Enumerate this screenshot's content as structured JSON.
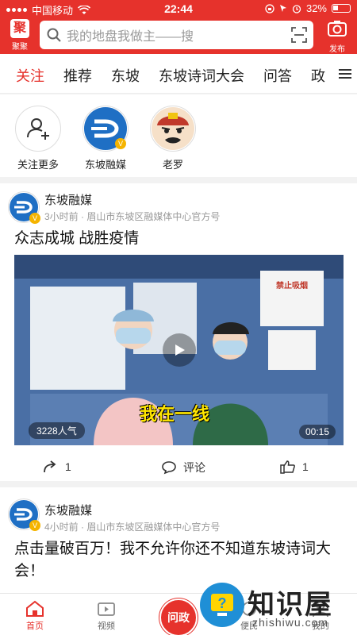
{
  "status_bar": {
    "carrier": "中国移动",
    "time": "22:44",
    "battery": "32%"
  },
  "header": {
    "logo_label": "聚聚",
    "search_placeholder": "我的地盘我做主——搜",
    "publish_label": "发布"
  },
  "tabs": [
    {
      "label": "关注",
      "active": true
    },
    {
      "label": "推荐"
    },
    {
      "label": "东坡"
    },
    {
      "label": "东坡诗词大会"
    },
    {
      "label": "问答"
    },
    {
      "label": "政"
    }
  ],
  "follow": {
    "items": [
      {
        "name": "关注更多"
      },
      {
        "name": "东坡融媒"
      },
      {
        "name": "老罗"
      }
    ]
  },
  "posts": [
    {
      "author": "东坡融媒",
      "meta": "3小时前 · 眉山市东坡区融媒体中心官方号",
      "title": "众志成城 战胜疫情",
      "video": {
        "views": "3228人气",
        "duration": "00:15",
        "caption": "我在一线",
        "sign_text": "禁止吸烟"
      },
      "actions": {
        "share_count": "1",
        "comment_label": "评论",
        "like_count": "1"
      }
    },
    {
      "author": "东坡融媒",
      "meta": "4小时前 · 眉山市东坡区融媒体中心官方号",
      "title": "点击量破百万！我不允许你还不知道东坡诗词大会！"
    }
  ],
  "bottom_nav": {
    "items": [
      {
        "label": "首页",
        "active": true
      },
      {
        "label": "视频"
      },
      {
        "label": "问政"
      },
      {
        "label": "便民"
      },
      {
        "label": "我的"
      }
    ]
  },
  "watermark": {
    "text": "知识屋",
    "sub": "zhishiwu.com"
  },
  "colors": {
    "brand_red": "#e6322c",
    "brand_blue": "#1f6fc4",
    "badge_gold": "#f5b400"
  }
}
